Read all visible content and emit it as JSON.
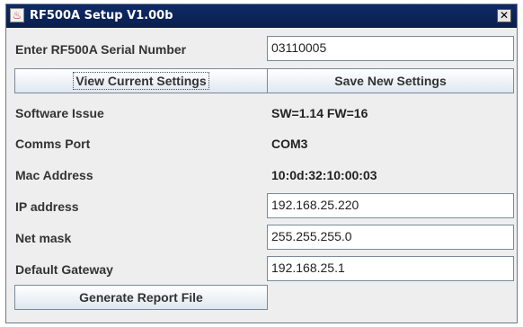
{
  "window": {
    "title": "RF500A Setup V1.00b",
    "close_glyph": "✕"
  },
  "serial": {
    "label": "Enter RF500A Serial Number",
    "value": "03110005"
  },
  "buttons": {
    "view_current": "View Current Settings",
    "save_new": "Save New Settings",
    "generate_report": "Generate Report File"
  },
  "info": {
    "software_issue_label": "Software Issue",
    "software_issue_value": "SW=1.14  FW=16",
    "comms_port_label": "Comms Port",
    "comms_port_value": "COM3",
    "mac_label": "Mac Address",
    "mac_value": "10:0d:32:10:00:03"
  },
  "network": {
    "ip_label": "IP address",
    "ip_value": "192.168.25.220",
    "netmask_label": "Net mask",
    "netmask_value": "255.255.255.0",
    "gateway_label": "Default Gateway",
    "gateway_value": "192.168.25.1"
  },
  "icons": {
    "app": "java-app-icon",
    "close": "close-icon"
  }
}
